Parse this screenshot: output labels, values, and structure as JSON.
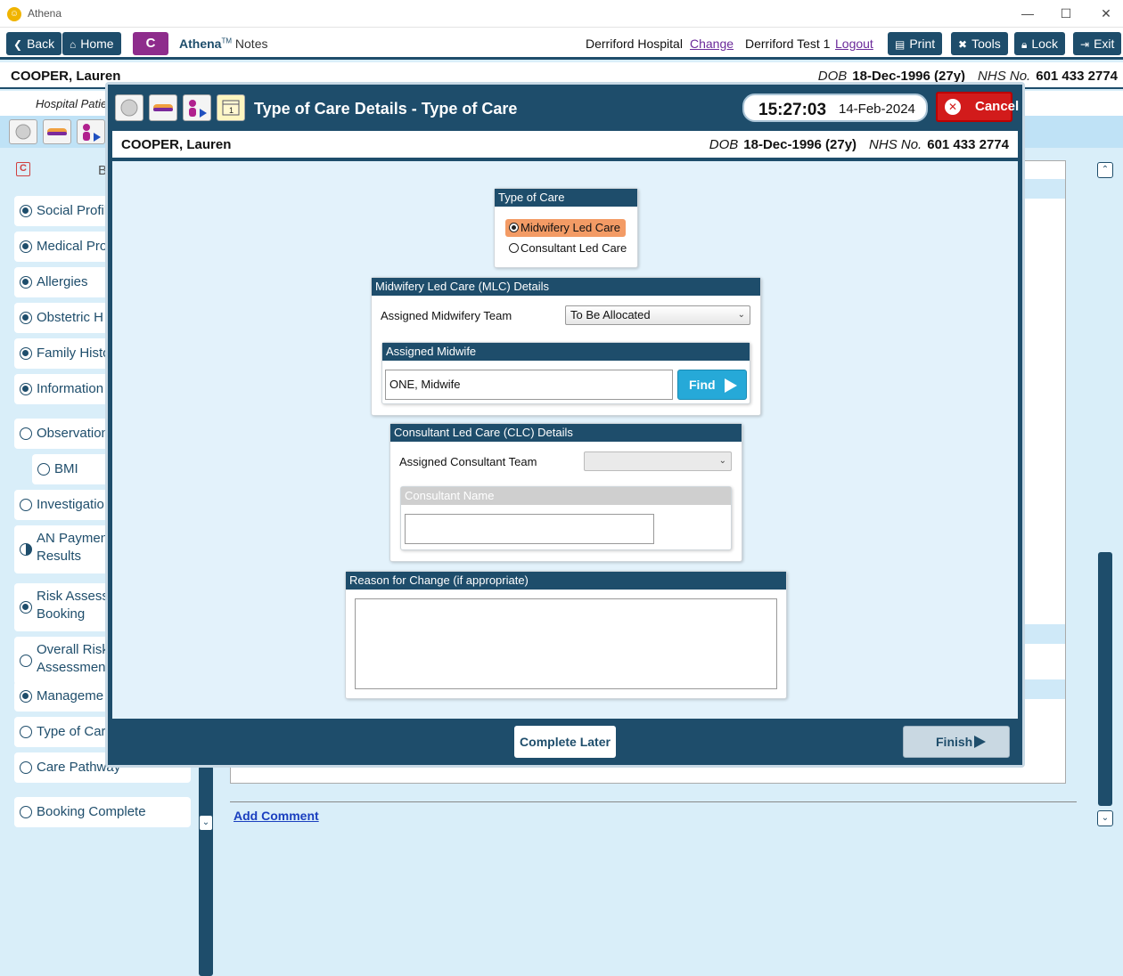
{
  "window": {
    "app_title": "Athena"
  },
  "toolbar": {
    "back": "Back",
    "home": "Home",
    "c_label": "C",
    "brand_name": "Athena",
    "brand_tm": "TM",
    "brand_sub": "Notes",
    "hospital": "Derriford Hospital",
    "change": "Change",
    "user": "Derriford Test 1",
    "logout": "Logout",
    "print": "Print",
    "tools": "Tools",
    "lock": "Lock",
    "exit": "Exit"
  },
  "patient": {
    "name": "COOPER, Lauren",
    "dob_label": "DOB",
    "dob": "18-Dec-1996 (27y)",
    "nhs_label": "NHS No.",
    "nhs": "601 433 2774"
  },
  "background": {
    "hospital_patient": "Hospital Patie",
    "add_comment": "Add Comment",
    "nav_header": "Bo"
  },
  "leftnav": {
    "items": [
      {
        "label": "Social Profil",
        "state": "on"
      },
      {
        "label": "Medical Pro",
        "state": "on"
      },
      {
        "label": "Allergies",
        "state": "on"
      },
      {
        "label": "Obstetric H",
        "state": "on"
      },
      {
        "label": "Family Histo",
        "state": "on"
      },
      {
        "label": "Information",
        "state": "on"
      },
      {
        "label": "Observation",
        "state": "off"
      },
      {
        "label": "BMI",
        "state": "off"
      },
      {
        "label": "Investigatio",
        "state": "off"
      },
      {
        "label": "AN Paymen",
        "label2": "Results",
        "state": "half"
      },
      {
        "label": "Risk Assess",
        "label2": "Booking",
        "state": "on"
      },
      {
        "label": "Overall Risk",
        "label2": "Assessment",
        "state": "off"
      },
      {
        "label": "Manageme",
        "state": "on"
      },
      {
        "label": "Type of Car",
        "state": "off"
      },
      {
        "label": "Care Pathway",
        "state": "off"
      },
      {
        "label": "Booking Complete",
        "state": "off"
      }
    ]
  },
  "modal": {
    "title": "Type of Care Details - Type of Care",
    "time": "15:27:03",
    "date": "14-Feb-2024",
    "cancel": "Cancel",
    "type_of_care": {
      "header": "Type of Care",
      "options": [
        "Midwifery Led Care",
        "Consultant Led Care"
      ],
      "selected": "Midwifery Led Care"
    },
    "mlc": {
      "header": "Midwifery Led Care (MLC) Details",
      "team_label": "Assigned Midwifery Team",
      "team_value": "To Be Allocated",
      "midwife_header": "Assigned Midwife",
      "midwife_value": "ONE, Midwife",
      "find": "Find"
    },
    "clc": {
      "header": "Consultant Led Care (CLC) Details",
      "team_label": "Assigned Consultant Team",
      "team_value": "",
      "consultant_header": "Consultant Name",
      "consultant_value": ""
    },
    "reason": {
      "header": "Reason for Change (if appropriate)",
      "value": ""
    },
    "complete_later": "Complete Later",
    "finish": "Finish"
  },
  "colors": {
    "primary": "#1e4d6b",
    "accent_selected": "#f39b65",
    "cancel": "#d21b1b",
    "find": "#26a9d8",
    "background": "#d9eef9"
  }
}
